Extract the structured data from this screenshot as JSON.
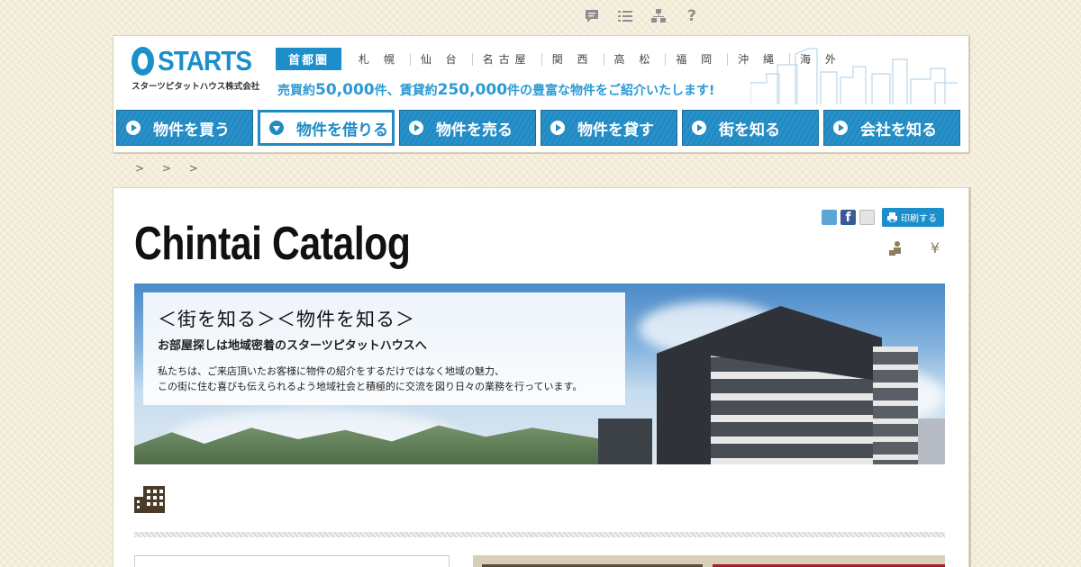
{
  "utility_icons": [
    "comment-icon",
    "list-icon",
    "sitemap-icon",
    "help-icon"
  ],
  "utility_help_glyph": "?",
  "logo": {
    "word": "STARTS",
    "sub": "スターツピタットハウス株式会社"
  },
  "region": {
    "main": "首都圏",
    "items": [
      "札 幌",
      "仙 台",
      "名古屋",
      "関 西",
      "高 松",
      "福 岡",
      "沖 縄",
      "海 外"
    ]
  },
  "tagline": {
    "p1": "売買約",
    "n1": "50,000",
    "p2": "件、賃貸約",
    "n2": "250,000",
    "p3": "件の豊富な物件をご紹介いたします!"
  },
  "nav": [
    {
      "label": "物件を買う",
      "active": false
    },
    {
      "label": "物件を借りる",
      "active": true
    },
    {
      "label": "物件を売る",
      "active": false
    },
    {
      "label": "物件を貸す",
      "active": false
    },
    {
      "label": "街を知る",
      "active": false
    },
    {
      "label": "会社を知る",
      "active": false
    }
  ],
  "breadcrumb": "> > >",
  "page_title": "Chintai Catalog",
  "share": {
    "fb": "f",
    "print_label": "印刷する"
  },
  "side_icons": {
    "yen": "¥"
  },
  "banner": {
    "heading": "＜街を知る＞＜物件を知る＞",
    "subheading": "お部屋探しは地域密着のスターツピタットハウスへ",
    "line1": "私たちは、ご来店頂いたお客様に物件の紹介をするだけではなく地域の魅力、",
    "line2": "この街に住む喜びも伝えられるよう地域社会と積極的に交流を図り日々の業務を行っています。"
  },
  "colors": {
    "accent": "#1f8ac4",
    "background": "#f3ecd9",
    "brown": "#5a4e3a",
    "red": "#a51d2e"
  }
}
